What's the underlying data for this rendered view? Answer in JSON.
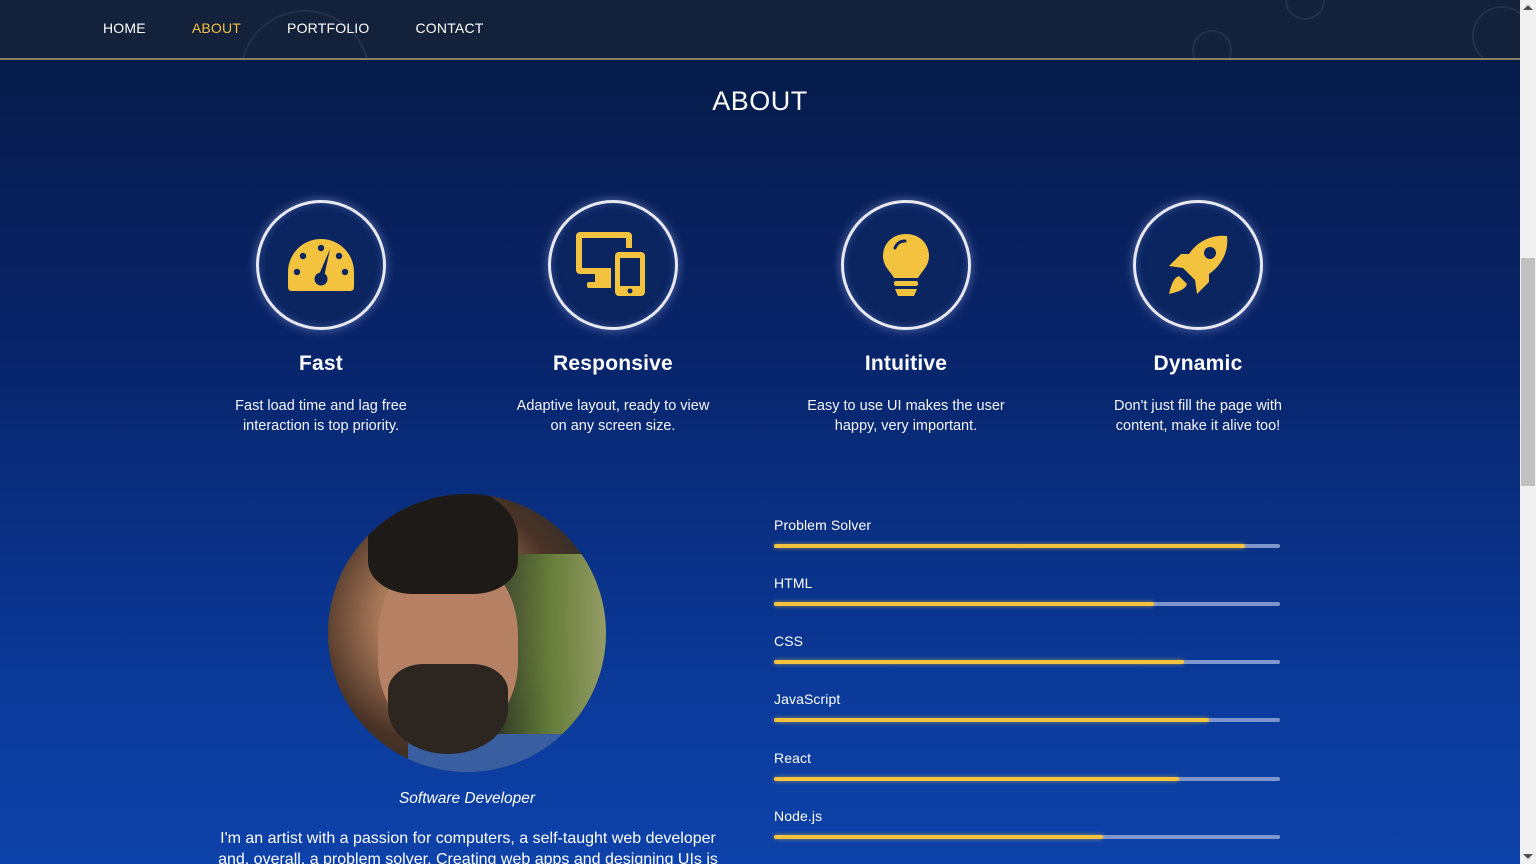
{
  "nav": {
    "items": [
      {
        "label": "HOME",
        "active": false
      },
      {
        "label": "ABOUT",
        "active": true
      },
      {
        "label": "PORTFOLIO",
        "active": false
      },
      {
        "label": "CONTACT",
        "active": false
      }
    ]
  },
  "section": {
    "title": "ABOUT"
  },
  "features": [
    {
      "icon": "speedometer-icon",
      "title": "Fast",
      "desc": "Fast load time and lag free interaction is top priority."
    },
    {
      "icon": "devices-icon",
      "title": "Responsive",
      "desc": "Adaptive layout, ready to view on any screen size."
    },
    {
      "icon": "lightbulb-icon",
      "title": "Intuitive",
      "desc": "Easy to use UI makes the user happy, very important."
    },
    {
      "icon": "rocket-icon",
      "title": "Dynamic",
      "desc": "Don't just fill the page with content, make it alive too!"
    }
  ],
  "profile": {
    "role": "Software Developer",
    "bio": "I'm an artist with a passion for computers, a self-taught web developer and, overall, a problem solver. Creating web apps and designing UIs is a"
  },
  "skills": [
    {
      "label": "Problem Solver",
      "level": 0.93
    },
    {
      "label": "HTML",
      "level": 0.75
    },
    {
      "label": "CSS",
      "level": 0.81
    },
    {
      "label": "JavaScript",
      "level": 0.86
    },
    {
      "label": "React",
      "level": 0.8
    },
    {
      "label": "Node.js",
      "level": 0.65
    }
  ],
  "colors": {
    "accent": "#f3c23f",
    "nav_bg": "#14213a",
    "track": "#7d97cc"
  }
}
